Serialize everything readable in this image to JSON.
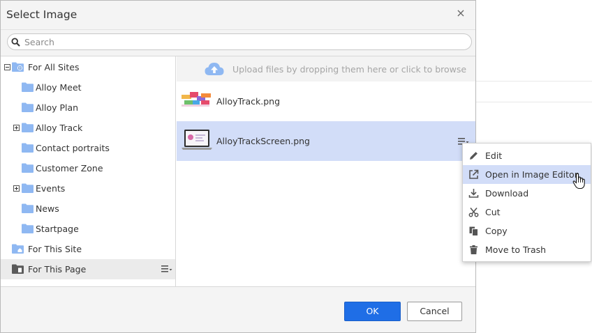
{
  "dialog": {
    "title": "Select Image",
    "close_glyph": "×"
  },
  "search": {
    "placeholder": "Search",
    "value": ""
  },
  "tree": {
    "items": [
      {
        "label": "For All Sites",
        "icon": "site-folder-icon"
      },
      {
        "label": "Alloy Meet",
        "icon": "folder-icon"
      },
      {
        "label": "Alloy Plan",
        "icon": "folder-icon"
      },
      {
        "label": "Alloy Track",
        "icon": "folder-icon",
        "expander": "plus"
      },
      {
        "label": "Contact portraits",
        "icon": "folder-icon"
      },
      {
        "label": "Customer Zone",
        "icon": "folder-icon"
      },
      {
        "label": "Events",
        "icon": "folder-icon",
        "expander": "plus"
      },
      {
        "label": "News",
        "icon": "folder-icon"
      },
      {
        "label": "Startpage",
        "icon": "folder-icon"
      },
      {
        "label": "For This Site",
        "icon": "home-folder-icon"
      },
      {
        "label": "For This Page",
        "icon": "page-folder-icon",
        "selected": true
      }
    ]
  },
  "upload": {
    "text": "Upload files by dropping them here or click to browse"
  },
  "files": [
    {
      "name": "AlloyTrack.png",
      "selected": false
    },
    {
      "name": "AlloyTrackScreen.png",
      "selected": true
    }
  ],
  "context_menu": {
    "items": [
      {
        "label": "Edit",
        "icon": "pencil-icon"
      },
      {
        "label": "Open in Image Editor",
        "icon": "external-link-icon",
        "hover": true
      },
      {
        "label": "Download",
        "icon": "download-icon"
      },
      {
        "label": "Cut",
        "icon": "scissors-icon"
      },
      {
        "label": "Copy",
        "icon": "copy-icon"
      },
      {
        "label": "Move to Trash",
        "icon": "trash-icon"
      }
    ]
  },
  "footer": {
    "ok_label": "OK",
    "cancel_label": "Cancel"
  },
  "colors": {
    "accent": "#1f6ee6",
    "selection": "#d2ddf8",
    "folder": "#8fb8f2"
  }
}
